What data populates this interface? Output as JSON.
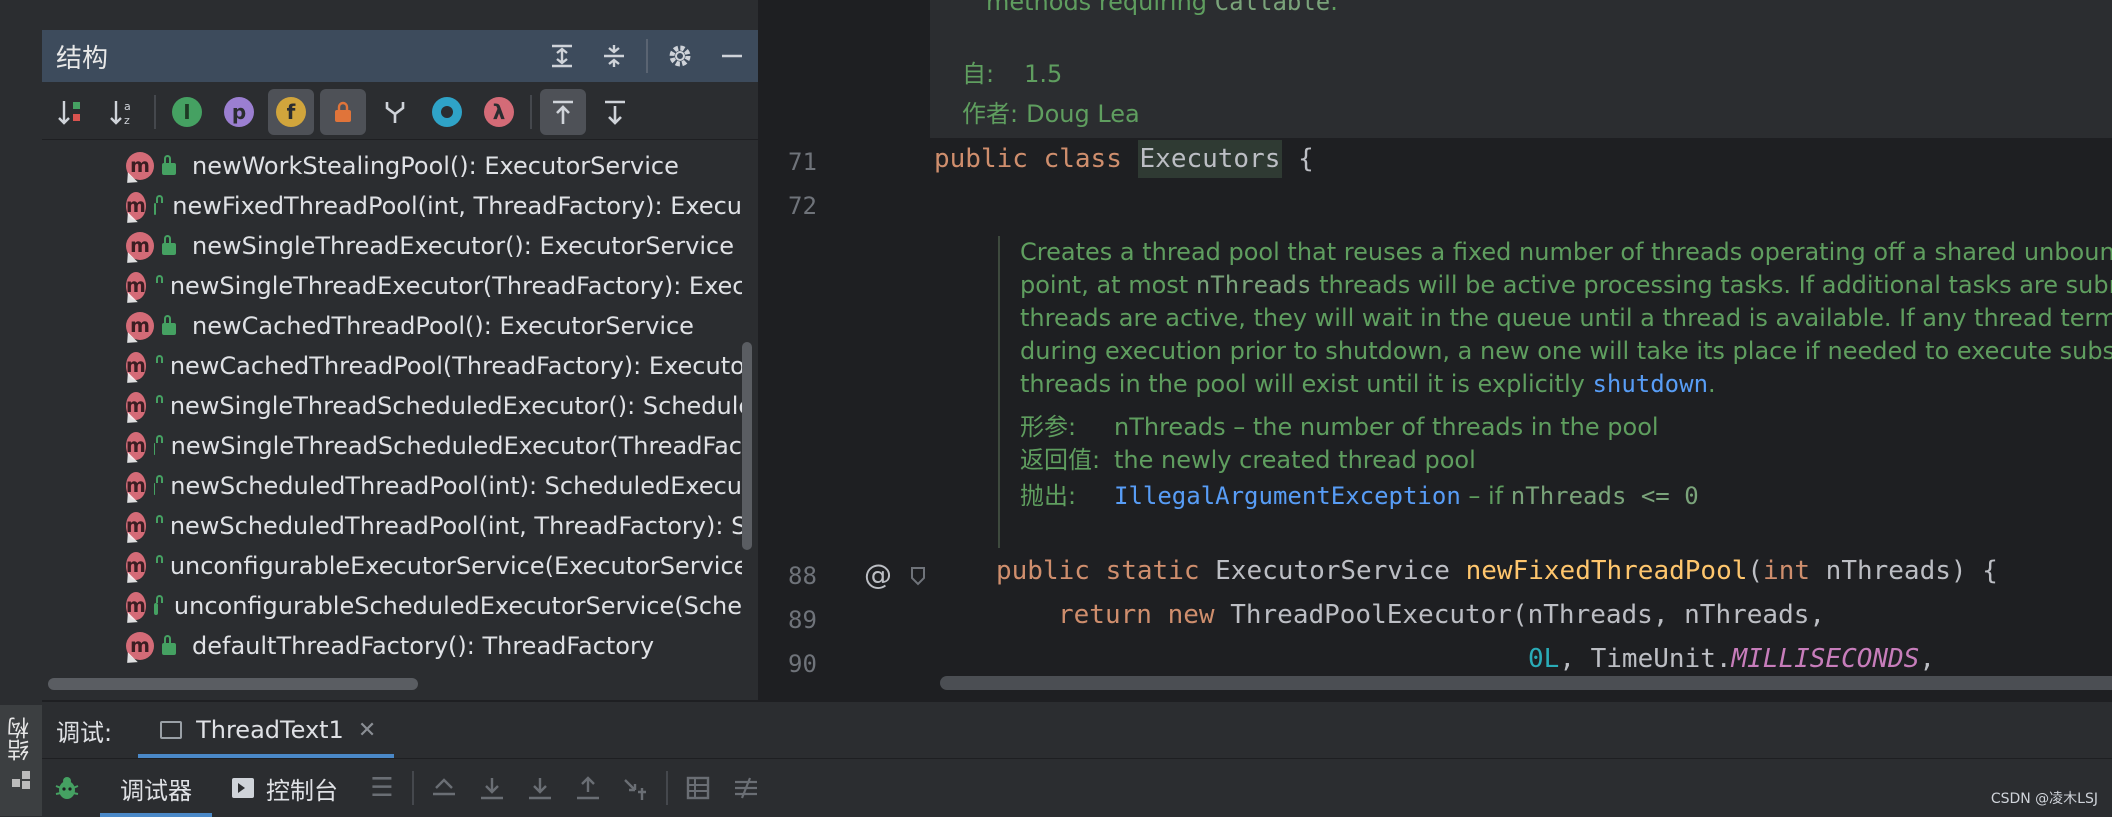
{
  "left_strip": {
    "vertical_tab_label": "结构"
  },
  "structure": {
    "title": "结构",
    "header_buttons": [
      "expand-all-icon",
      "collapse-all-icon",
      "gear-icon",
      "minimize-icon"
    ],
    "toolbar_icons": [
      "sort-visibility-icon",
      "sort-alphabetically-icon",
      "show-inherited-icon",
      "show-properties-icon",
      "show-fields-icon",
      "show-non-public-icon",
      "show-hierarchy-icon",
      "show-anonymous-icon",
      "show-lambdas-icon",
      "autoscroll-to-source-icon",
      "autoscroll-from-source-icon"
    ],
    "toolbar_letters": {
      "p": "p",
      "f": "f",
      "lambda": "λ"
    },
    "items": [
      "newWorkStealingPool(): ExecutorService",
      "newFixedThreadPool(int, ThreadFactory): Execu",
      "newSingleThreadExecutor(): ExecutorService",
      "newSingleThreadExecutor(ThreadFactory): Exec",
      "newCachedThreadPool(): ExecutorService",
      "newCachedThreadPool(ThreadFactory): Executo",
      "newSingleThreadScheduledExecutor(): Schedule",
      "newSingleThreadScheduledExecutor(ThreadFac",
      "newScheduledThreadPool(int): ScheduledExecu",
      "newScheduledThreadPool(int, ThreadFactory): S",
      "unconfigurableExecutorService(ExecutorService",
      "unconfigurableScheduledExecutorService(Sche",
      "defaultThreadFactory(): ThreadFactory"
    ],
    "method_badge": "m"
  },
  "editor": {
    "doc_top": {
      "line0": "methods requiring ",
      "line0_code": "Callable",
      "line0_end": ".",
      "since_label": "自:",
      "since_value": "1.5",
      "author_label": "作者:",
      "author_value": "Doug Lea"
    },
    "line_numbers": {
      "l71": "71",
      "l72": "72",
      "l88": "88",
      "l89": "89",
      "l90": "90"
    },
    "gutter_at": "@",
    "class_line": {
      "kw1": "public",
      "kw2": "class",
      "name": "Executors",
      "brace": "{"
    },
    "docblock": {
      "lines": [
        "Creates a thread pool that reuses a fixed number of threads operating off a shared unbounded que",
        "point, at most ",
        "threads will be active processing tasks. If additional tasks are submitted",
        "threads are active, they will wait in the queue until a thread is available. If any thread terminates du",
        "during execution prior to shutdown, a new one will take its place if needed to execute subsequent t",
        "threads in the pool will exist until it is explicitly "
      ],
      "code_nThreads": "nThreads",
      "link_shutdown": "shutdown",
      "period": ".",
      "param_label": "形参:",
      "param_value": "nThreads – the number of threads in the pool",
      "return_label": "返回值:",
      "return_value": "the newly created thread pool",
      "throws_label": "抛出:",
      "throws_link": "IllegalArgumentException",
      "throws_text": " – if ",
      "throws_code": "nThreads <= 0"
    },
    "line88": {
      "kw1": "public",
      "kw2": "static",
      "type": "ExecutorService",
      "fn": "newFixedThreadPool",
      "open": "(",
      "kw3": "int",
      "param": " nThreads",
      "close": ") {"
    },
    "line89": {
      "kw": "return",
      "kw2": "new",
      "rest": " ThreadPoolExecutor(nThreads, nThreads,"
    },
    "line90": {
      "num": "0L",
      "mid": ", TimeUnit.",
      "const": "MILLISECONDS",
      "end": ","
    }
  },
  "debug": {
    "label": "调试:",
    "tab_label": "ThreadText1",
    "close": "✕",
    "sub_tabs": [
      "调试器",
      "控制台"
    ]
  },
  "watermark": "CSDN @凌木LSJ",
  "colors": {
    "accent": "#4a88c7",
    "method_badge": "#d46b77",
    "doc_green": "#5f9e5f",
    "keyword": "#cf8e6d",
    "function": "#ffc66d"
  }
}
